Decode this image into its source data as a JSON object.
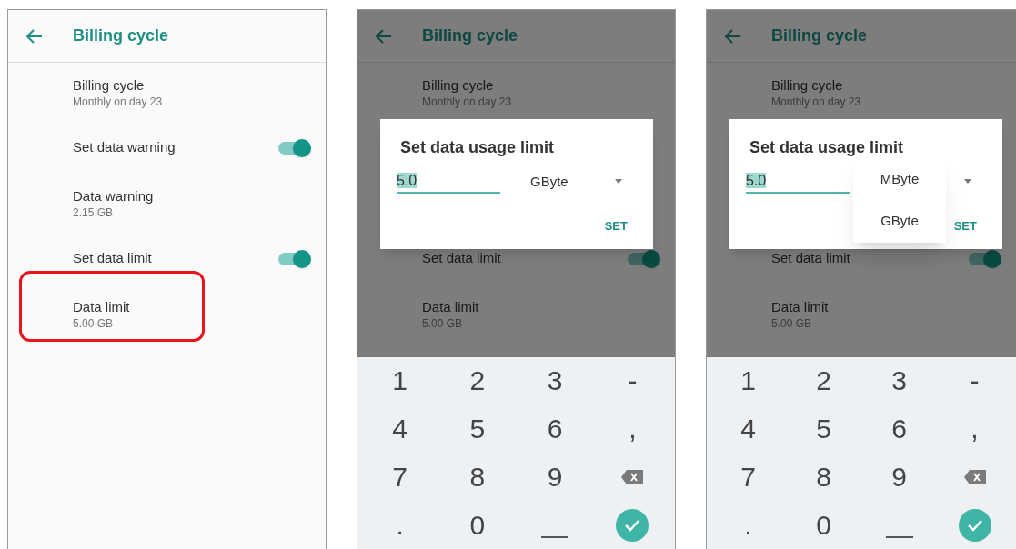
{
  "panels": [
    {
      "header": {
        "title": "Billing cycle"
      },
      "dimmed": false,
      "items": [
        {
          "kind": "text",
          "title": "Billing cycle",
          "summary": "Monthly on day 23",
          "highlighted": false
        },
        {
          "kind": "switch",
          "title": "Set data warning",
          "on": true
        },
        {
          "kind": "text",
          "title": "Data warning",
          "summary": "2.15 GB",
          "highlighted": false
        },
        {
          "kind": "switch",
          "title": "Set data limit",
          "on": true
        },
        {
          "kind": "text",
          "title": "Data limit",
          "summary": "5.00 GB",
          "highlighted": true
        }
      ]
    },
    {
      "header": {
        "title": "Billing cycle"
      },
      "dimmed": true,
      "items": [
        {
          "kind": "text",
          "title": "Billing cycle",
          "summary": "Monthly on day 23"
        },
        {
          "kind": "switch",
          "title": "Set data limit",
          "on": true
        },
        {
          "kind": "text",
          "title": "Data limit",
          "summary": "5.00 GB"
        }
      ],
      "dialog": {
        "title": "Set data usage limit",
        "value": "5.0",
        "unit": "GByte",
        "button": "SET"
      },
      "keyboard": {
        "keys": [
          {
            "kind": "char",
            "label": "1"
          },
          {
            "kind": "char",
            "label": "2"
          },
          {
            "kind": "char",
            "label": "3"
          },
          {
            "kind": "char",
            "label": "-"
          },
          {
            "kind": "char",
            "label": "4"
          },
          {
            "kind": "char",
            "label": "5"
          },
          {
            "kind": "char",
            "label": "6"
          },
          {
            "kind": "char",
            "label": ","
          },
          {
            "kind": "char",
            "label": "7"
          },
          {
            "kind": "char",
            "label": "8"
          },
          {
            "kind": "char",
            "label": "9"
          },
          {
            "kind": "backspace"
          },
          {
            "kind": "char",
            "label": "."
          },
          {
            "kind": "char",
            "label": "0"
          },
          {
            "kind": "space"
          },
          {
            "kind": "done"
          }
        ]
      }
    },
    {
      "header": {
        "title": "Billing cycle"
      },
      "dimmed": true,
      "items": [
        {
          "kind": "text",
          "title": "Billing cycle",
          "summary": "Monthly on day 23"
        },
        {
          "kind": "switch",
          "title": "Set data limit",
          "on": true
        },
        {
          "kind": "text",
          "title": "Data limit",
          "summary": "5.00 GB"
        }
      ],
      "dialog": {
        "title": "Set data usage limit",
        "value": "5.0",
        "button": "SET"
      },
      "dropdown": {
        "options": [
          "MByte",
          "GByte"
        ]
      },
      "keyboard": {
        "keys": [
          {
            "kind": "char",
            "label": "1"
          },
          {
            "kind": "char",
            "label": "2"
          },
          {
            "kind": "char",
            "label": "3"
          },
          {
            "kind": "char",
            "label": "-"
          },
          {
            "kind": "char",
            "label": "4"
          },
          {
            "kind": "char",
            "label": "5"
          },
          {
            "kind": "char",
            "label": "6"
          },
          {
            "kind": "char",
            "label": ","
          },
          {
            "kind": "char",
            "label": "7"
          },
          {
            "kind": "char",
            "label": "8"
          },
          {
            "kind": "char",
            "label": "9"
          },
          {
            "kind": "backspace"
          },
          {
            "kind": "char",
            "label": "."
          },
          {
            "kind": "char",
            "label": "0"
          },
          {
            "kind": "space"
          },
          {
            "kind": "done"
          }
        ]
      }
    }
  ]
}
